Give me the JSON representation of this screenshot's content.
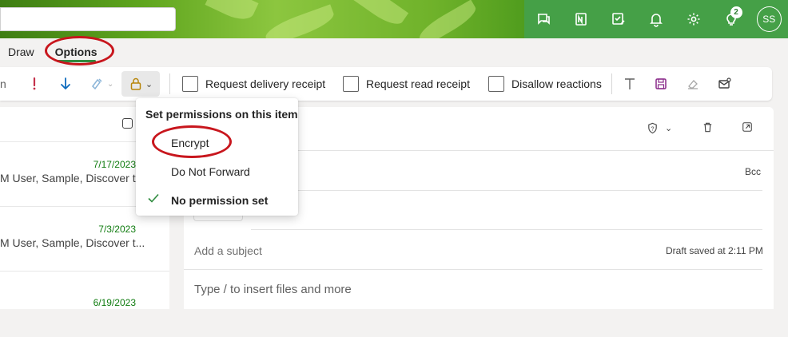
{
  "header": {
    "badge_count": "2",
    "avatar_initials": "SS",
    "icons": [
      "chat-icon",
      "onenote-icon",
      "todo-icon",
      "bell-icon",
      "gear-icon",
      "lightbulb-icon"
    ]
  },
  "tabs": [
    {
      "label": "Draw"
    },
    {
      "label": "Options",
      "active": true
    }
  ],
  "ribbon": {
    "request_delivery_receipt": "Request delivery receipt",
    "request_read_receipt": "Request read receipt",
    "disallow_reactions": "Disallow reactions"
  },
  "permissions_menu": {
    "title": "Set permissions on this item",
    "items": [
      {
        "label": "Encrypt"
      },
      {
        "label": "Do Not Forward"
      },
      {
        "label": "No permission set",
        "selected": true
      }
    ]
  },
  "mail_list": {
    "items": [
      {
        "date": "7/17/2023",
        "from": "M User, Sample, Discover t..."
      },
      {
        "date": "7/3/2023",
        "from": "M User, Sample, Discover t..."
      },
      {
        "date": "6/19/2023",
        "from": ""
      }
    ]
  },
  "compose": {
    "bcc_label": "Bcc",
    "subject_placeholder": "Add a subject",
    "draft_status": "Draft saved at 2:11 PM",
    "body_placeholder": "Type / to insert files and more"
  },
  "colors": {
    "accent_green": "#2e8b3e",
    "annotation_red": "#c8161d",
    "date_green": "#107c10",
    "importance_red": "#c4314b",
    "arrow_blue": "#0f6cbd"
  }
}
